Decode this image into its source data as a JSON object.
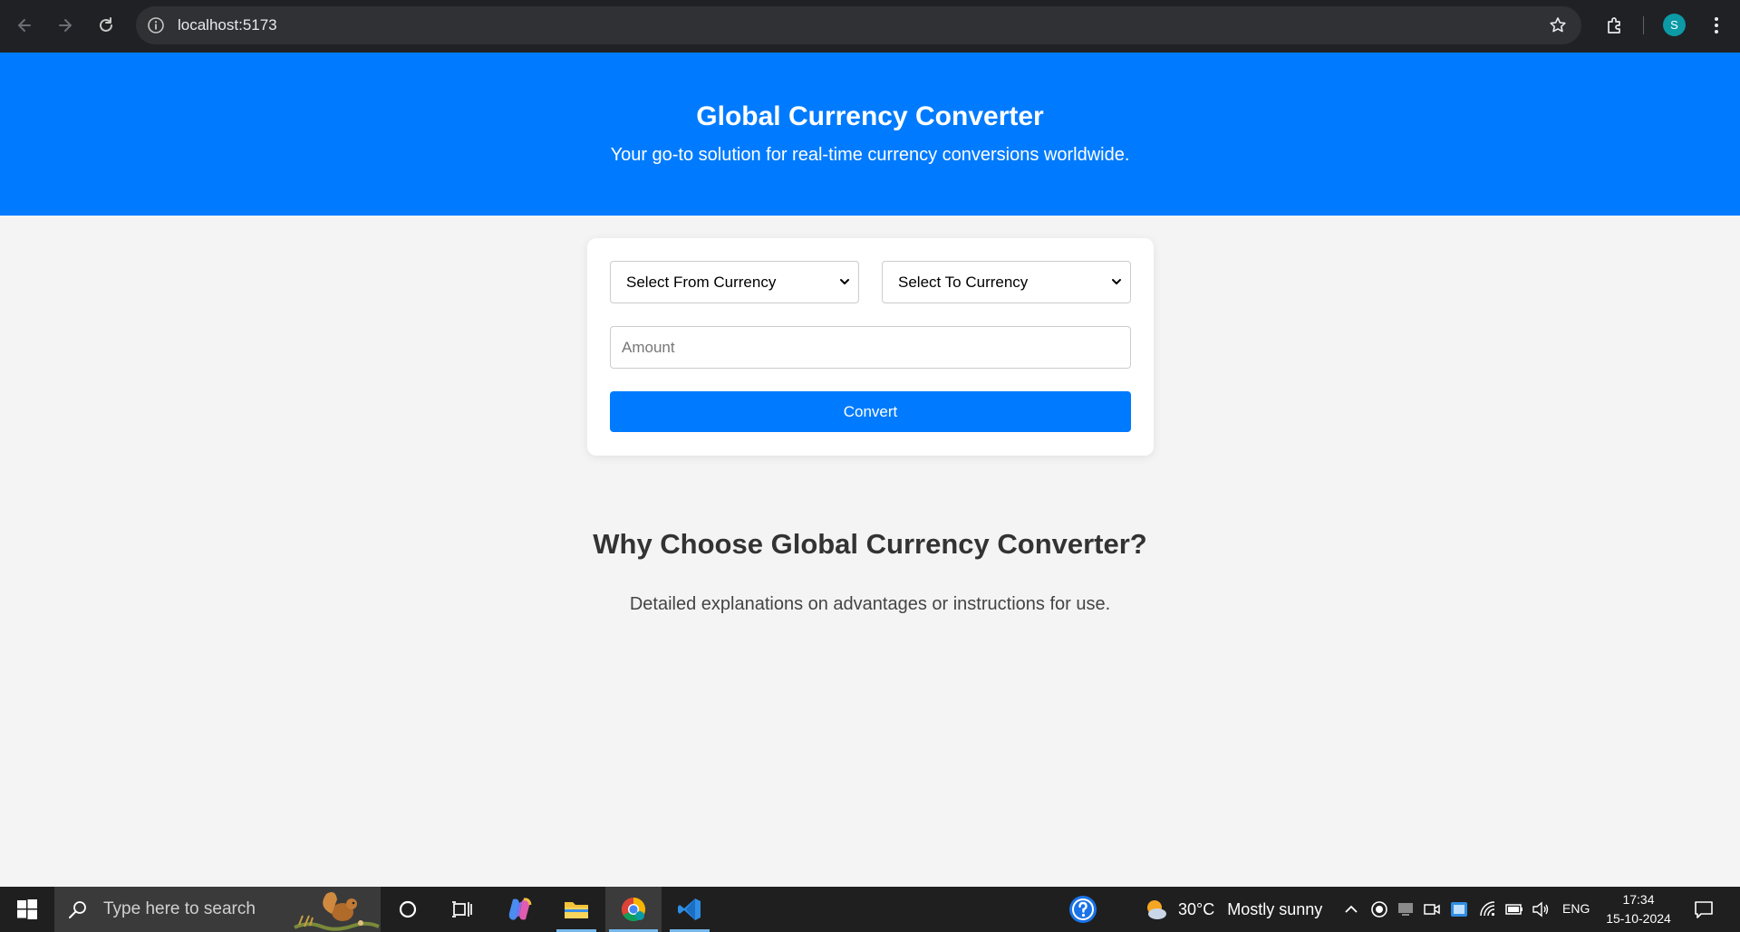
{
  "browser": {
    "url": "localhost:5173",
    "profile_initial": "S"
  },
  "hero": {
    "title": "Global Currency Converter",
    "subtitle": "Your go-to solution for real-time currency conversions worldwide."
  },
  "converter": {
    "from_select": "Select From Currency",
    "to_select": "Select To Currency",
    "amount_placeholder": "Amount",
    "amount_value": "",
    "convert_label": "Convert"
  },
  "why": {
    "title": "Why Choose Global Currency Converter?",
    "text": "Detailed explanations on advantages or instructions for use."
  },
  "taskbar": {
    "search_placeholder": "Type here to search",
    "temperature": "30°C",
    "condition": "Mostly sunny",
    "language": "ENG",
    "time": "17:34",
    "date": "15-10-2024"
  },
  "colors": {
    "brand_blue": "#007bff",
    "chrome_dark": "#202124",
    "taskbar": "#1f1f1f"
  }
}
